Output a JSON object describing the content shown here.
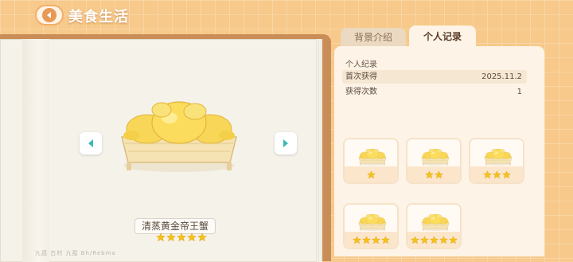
{
  "header": {
    "title": "美食生活"
  },
  "dish": {
    "name": "清蒸黄金帝王蟹",
    "stars": 5
  },
  "footer": {
    "text": "九孤  古村  九孤  Bh/Rebma"
  },
  "tabs": [
    {
      "label": "背景介绍",
      "active": false
    },
    {
      "label": "个人记录",
      "active": true
    }
  ],
  "record": {
    "section_title": "个人纪录",
    "rows": [
      {
        "label": "首次获得",
        "value": "2025.11.2"
      },
      {
        "label": "获得次数",
        "value": "1"
      }
    ]
  },
  "variants": [
    {
      "stars": 1
    },
    {
      "stars": 2
    },
    {
      "stars": 3
    },
    {
      "stars": 4
    },
    {
      "stars": 5
    }
  ],
  "colors": {
    "star": "#f5c21b",
    "accent": "#e79a55",
    "gold": "#f3cf4a"
  }
}
